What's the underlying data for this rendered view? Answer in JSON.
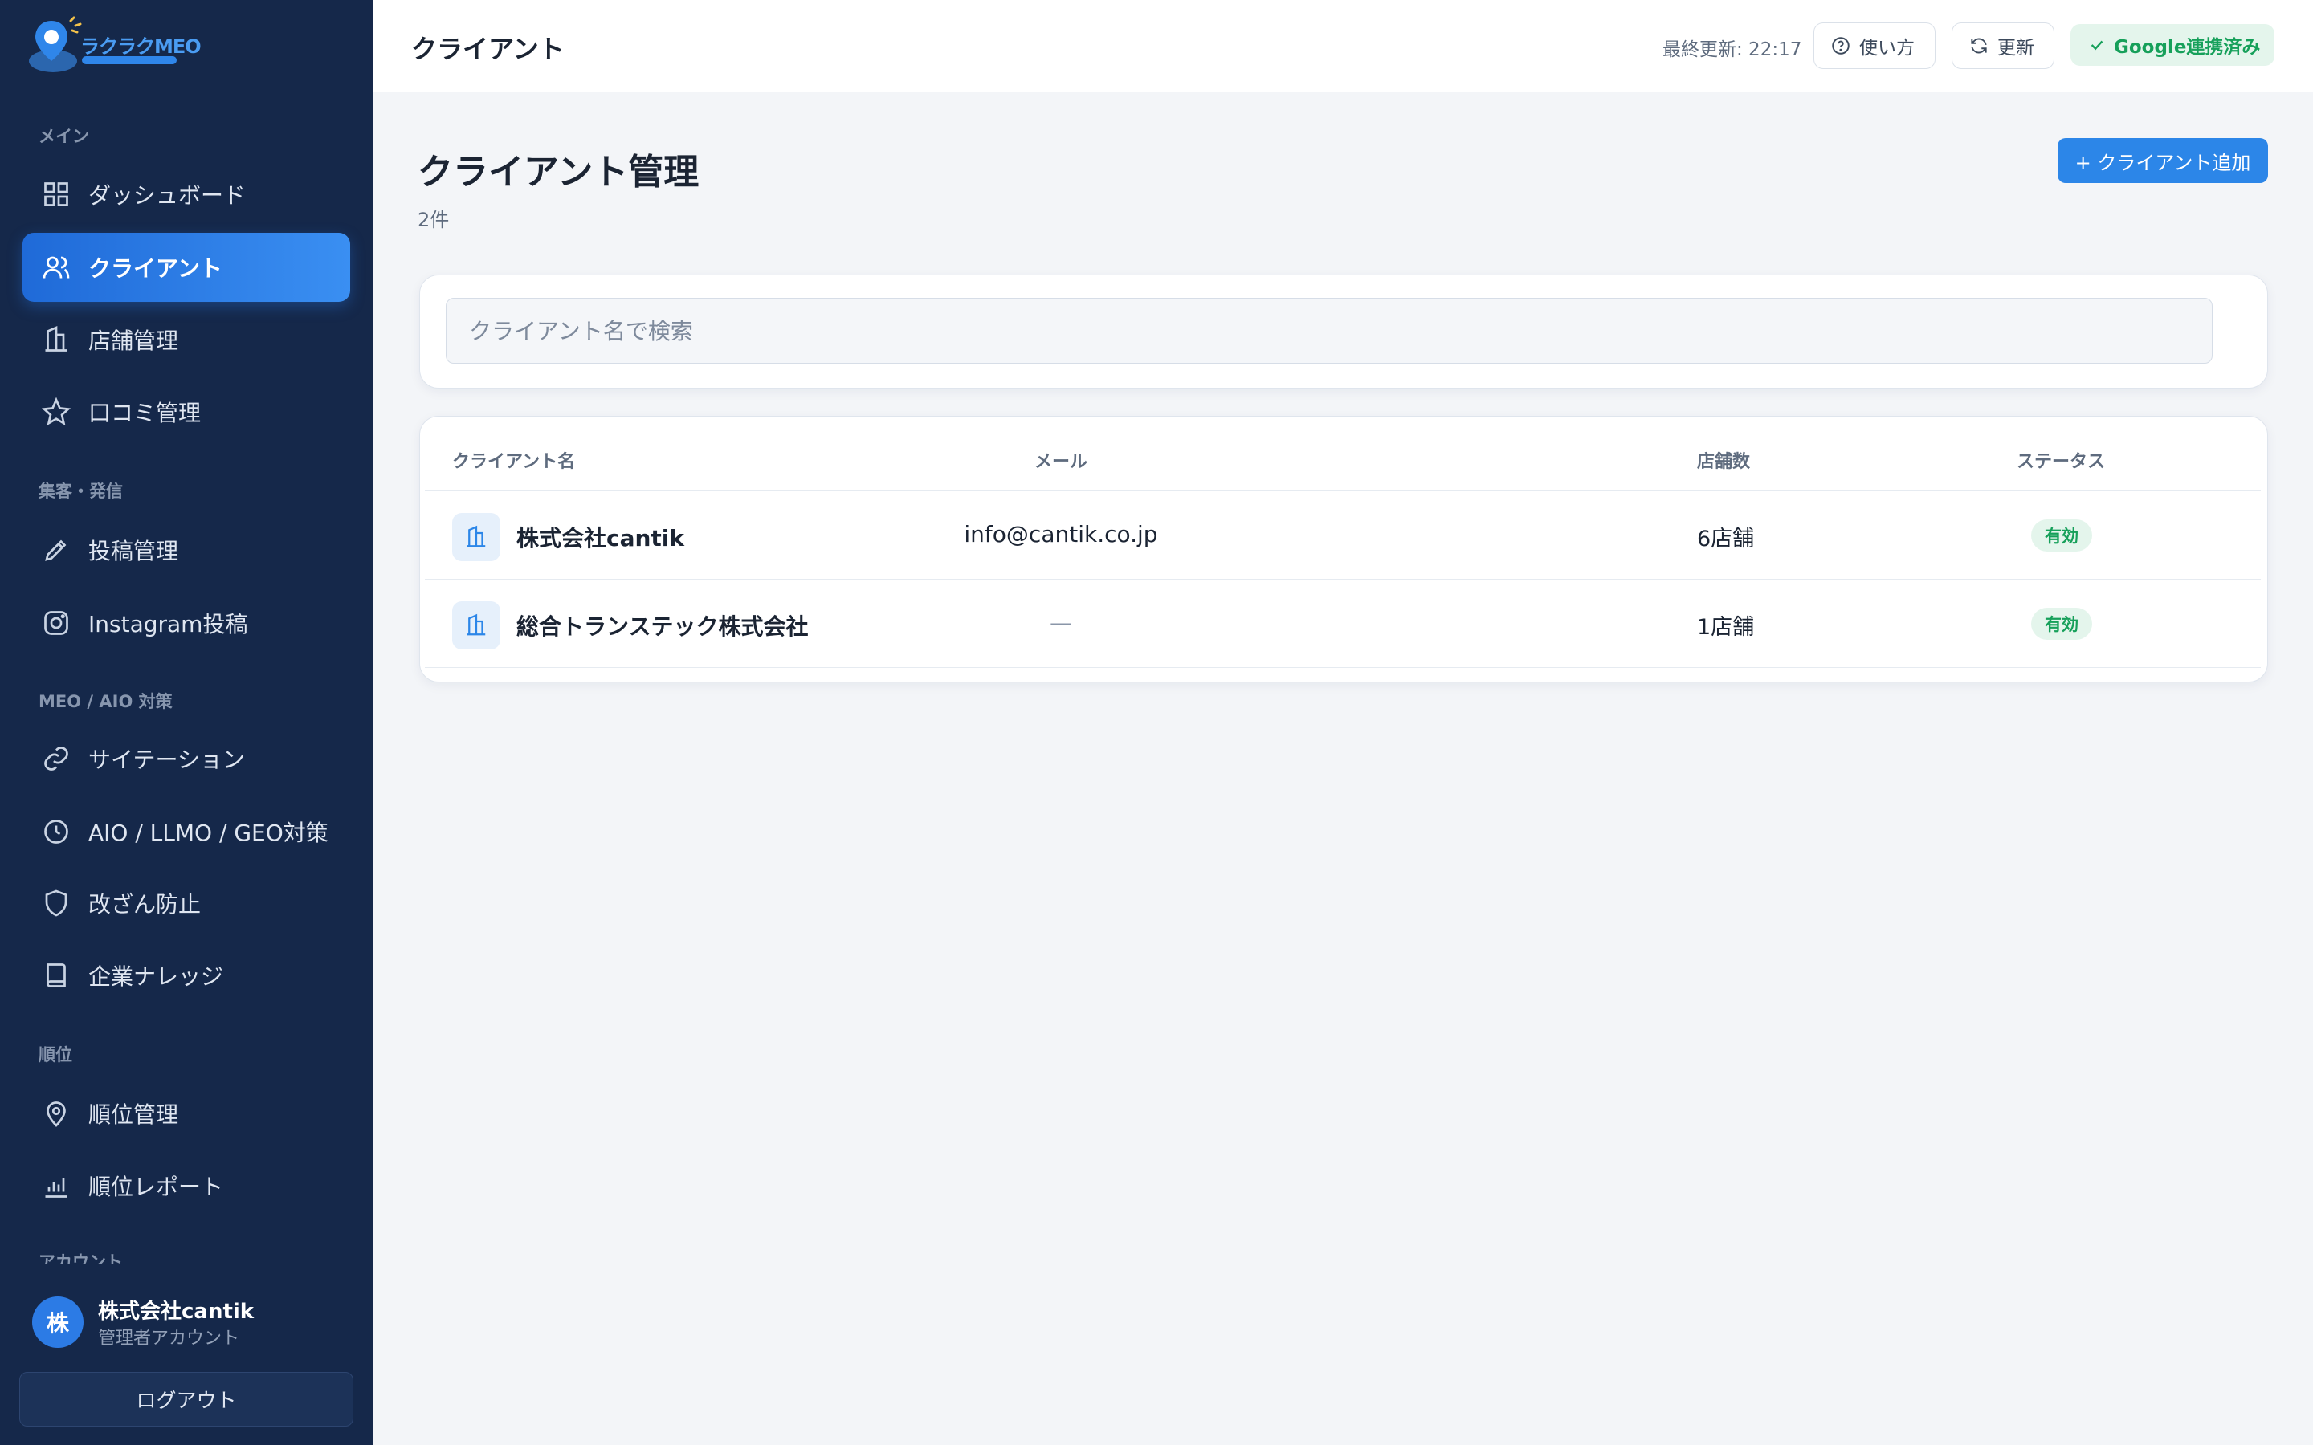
{
  "app": {
    "logo_text": "ラクラクMEO"
  },
  "sidebar": {
    "sections": [
      {
        "label": "メイン"
      },
      {
        "label": "集客・発信"
      },
      {
        "label": "MEO / AIO 対策"
      },
      {
        "label": "順位"
      },
      {
        "label": "アカウント"
      }
    ],
    "items": [
      {
        "label": "ダッシュボード",
        "icon": "grid-icon"
      },
      {
        "label": "クライアント",
        "icon": "users-icon",
        "active": true
      },
      {
        "label": "店舗管理",
        "icon": "building-icon"
      },
      {
        "label": "口コミ管理",
        "icon": "star-icon"
      },
      {
        "label": "投稿管理",
        "icon": "pen-icon"
      },
      {
        "label": "Instagram投稿",
        "icon": "instagram-icon"
      },
      {
        "label": "サイテーション",
        "icon": "link-icon"
      },
      {
        "label": "AIO / LLMO / GEO対策",
        "icon": "clock-icon"
      },
      {
        "label": "改ざん防止",
        "icon": "shield-icon"
      },
      {
        "label": "企業ナレッジ",
        "icon": "book-icon"
      },
      {
        "label": "順位管理",
        "icon": "map-pin-icon"
      },
      {
        "label": "順位レポート",
        "icon": "bar-chart-icon"
      }
    ]
  },
  "user": {
    "avatar_initial": "株",
    "name": "株式会社cantik",
    "role": "管理者アカウント",
    "logout_label": "ログアウト"
  },
  "topbar": {
    "title": "クライアント",
    "last_updated": "最終更新: 22:17",
    "help_label": "使い方",
    "refresh_label": "更新",
    "google_status": "Google連携済み"
  },
  "main": {
    "title": "クライアント管理",
    "count": "2件",
    "add_button": "+ クライアント追加",
    "search_placeholder": "クライアント名で検索",
    "table": {
      "headers": {
        "name": "クライアント名",
        "email": "メール",
        "stores": "店舗数",
        "status": "ステータス"
      },
      "rows": [
        {
          "name": "株式会社cantik",
          "email": "info@cantik.co.jp",
          "stores": "6店舗",
          "status": "有効"
        },
        {
          "name": "総合トランステック株式会社",
          "email": "—",
          "stores": "1店舗",
          "status": "有効"
        }
      ]
    }
  },
  "colors": {
    "sidebar_bg": "#15284a",
    "accent": "#2c86e8",
    "success": "#16a05a"
  }
}
